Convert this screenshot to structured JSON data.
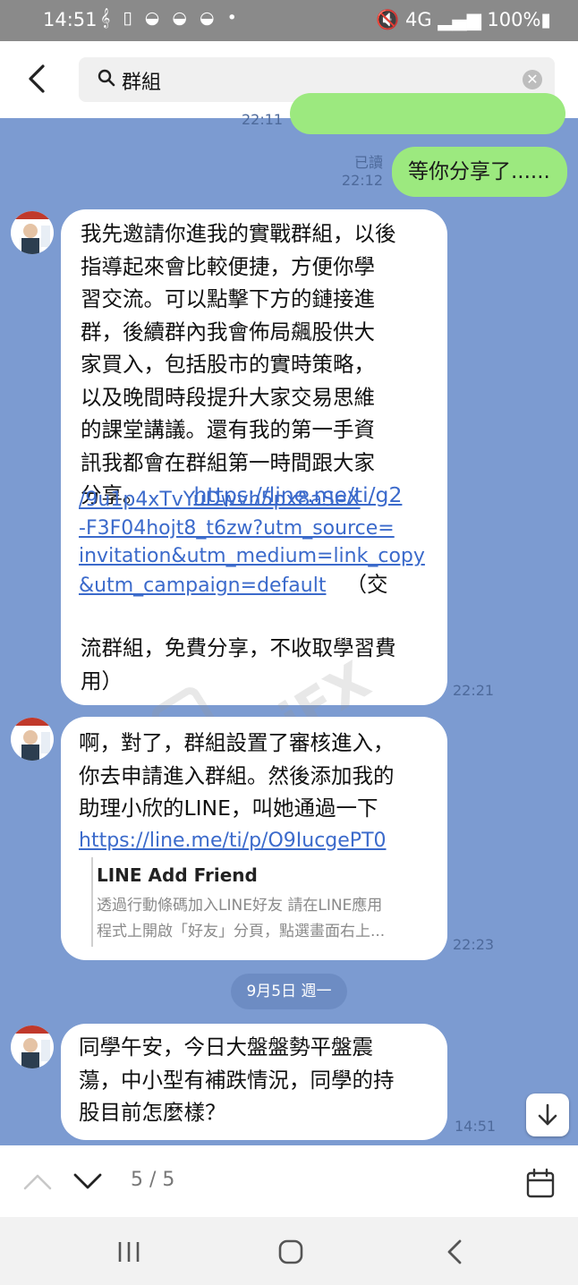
{
  "status_bar": {
    "time": "14:51",
    "notifications": "𝄞 ▯ ◒ ◒ ◒ •",
    "right": "🔇 4G ▂▄▆ 100%▮"
  },
  "search": {
    "query": "群組"
  },
  "messages": {
    "prev_time": "22:11",
    "sent": {
      "read_label": "已讀",
      "time": "22:12",
      "text": "等你分享了......"
    },
    "msg1": {
      "lines": [
        "我先邀請你進我的實戰群組，以後",
        "指導起來會比較便捷，方便你學",
        "習交流。可以點擊下方的鏈接進",
        "群，後續群內我會佈局飆股供大",
        "家買入，包括股市的實時策略，",
        "以及晚間時段提升大家交易思維",
        "的課堂講議。還有我的第一手資",
        "訊我都會在群組第一時間跟大家"
      ],
      "line9_text": "分享。",
      "link_lines": [
        "https://line.me/ti/g2",
        "/9u1p4xTvYuDwvh5px8aSeX",
        "-F3F04hojt8_t6zw?utm_source=",
        "invitation&utm_medium=link_copy",
        "&utm_campaign=default"
      ],
      "tail_first": "（交",
      "tail_lines": [
        "流群組，免費分享，不收取學習費",
        "用）"
      ],
      "time": "22:21"
    },
    "msg2": {
      "lines": [
        "啊，對了，群組設置了審核進入，",
        "你去申請進入群組。然後添加我的",
        "助理小欣的LINE，叫她通過一下"
      ],
      "link": "https://line.me/ti/p/O9IucgePT0",
      "preview_title": "LINE Add Friend",
      "preview_desc": [
        "透過行動條碼加入LINE好友 請在LINE應用",
        "程式上開啟「好友」分頁，點選畫面右上..."
      ],
      "time": "22:23"
    },
    "date_separator": "9月5日 週一",
    "msg3": {
      "lines": [
        "同學午安，今日大盤盤勢平盤震",
        "蕩，中小型有補跌情況，同學的持",
        "股目前怎麼樣？"
      ],
      "time": "14:51"
    }
  },
  "result_nav": {
    "counter": "5 / 5"
  },
  "watermark": "WikiFX",
  "colors": {
    "chat_bg": "#7c9bd1",
    "sent_bubble": "#9ce97f",
    "received_bubble": "#ffffff",
    "link": "#3b6acb"
  }
}
